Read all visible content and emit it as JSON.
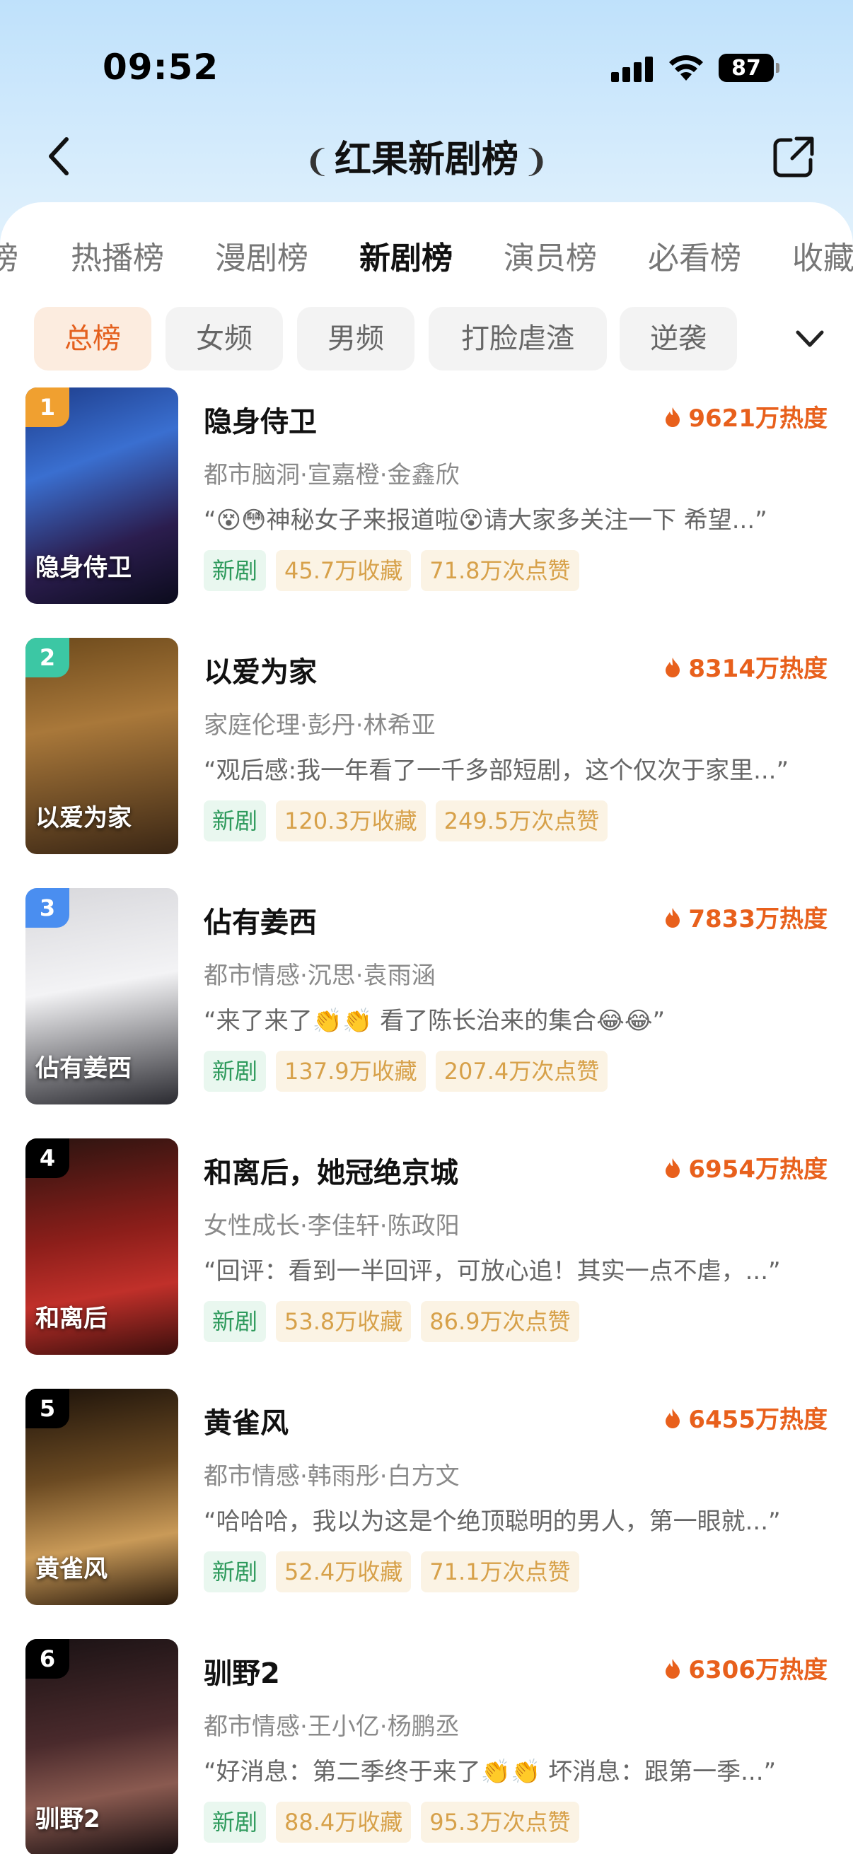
{
  "status": {
    "time": "09:52",
    "battery": "87"
  },
  "header": {
    "title": "红果新剧榜"
  },
  "tabs": [
    {
      "label": "热播榜",
      "active": false
    },
    {
      "label": "漫剧榜",
      "active": false
    },
    {
      "label": "新剧榜",
      "active": true
    },
    {
      "label": "演员榜",
      "active": false
    },
    {
      "label": "必看榜",
      "active": false
    },
    {
      "label": "收藏榜",
      "active": false
    }
  ],
  "chips": [
    {
      "label": "总榜",
      "active": true
    },
    {
      "label": "女频",
      "active": false
    },
    {
      "label": "男频",
      "active": false
    },
    {
      "label": "打脸虐渣",
      "active": false
    },
    {
      "label": "逆袭",
      "active": false
    }
  ],
  "items": [
    {
      "rank": "1",
      "title": "隐身侍卫",
      "heat": "9621万热度",
      "meta": "都市脑洞·宣嘉橙·金鑫欣",
      "quote": "“😵😳神秘女子来报道啦😵请大家多关注一下 希望...”",
      "tag": "新剧",
      "collect": "45.7万收藏",
      "likes": "71.8万次点赞",
      "poster_text": "隐身侍卫"
    },
    {
      "rank": "2",
      "title": "以爱为家",
      "heat": "8314万热度",
      "meta": "家庭伦理·彭丹·林希亚",
      "quote": "“观后感:我一年看了一千多部短剧，这个仅次于家里...”",
      "tag": "新剧",
      "collect": "120.3万收藏",
      "likes": "249.5万次点赞",
      "poster_text": "以爱为家"
    },
    {
      "rank": "3",
      "title": "佔有姜西",
      "heat": "7833万热度",
      "meta": "都市情感·沉思·袁雨涵",
      "quote": "“来了来了👏👏 看了陈长治来的集合😂😂”",
      "tag": "新剧",
      "collect": "137.9万收藏",
      "likes": "207.4万次点赞",
      "poster_text": "佔有姜西"
    },
    {
      "rank": "4",
      "title": "和离后，她冠绝京城",
      "heat": "6954万热度",
      "meta": "女性成长·李佳轩·陈政阳",
      "quote": "“回评：看到一半回评，可放心追！其实一点不虐，...”",
      "tag": "新剧",
      "collect": "53.8万收藏",
      "likes": "86.9万次点赞",
      "poster_text": "和离后"
    },
    {
      "rank": "5",
      "title": "黄雀风",
      "heat": "6455万热度",
      "meta": "都市情感·韩雨彤·白方文",
      "quote": "“哈哈哈，我以为这是个绝顶聪明的男人，第一眼就...”",
      "tag": "新剧",
      "collect": "52.4万收藏",
      "likes": "71.1万次点赞",
      "poster_text": "黄雀风"
    },
    {
      "rank": "6",
      "title": "驯野2",
      "heat": "6306万热度",
      "meta": "都市情感·王小亿·杨鹏丞",
      "quote": "“好消息：第二季终于来了👏👏 坏消息：跟第一季...”",
      "tag": "新剧",
      "collect": "88.4万收藏",
      "likes": "95.3万次点赞",
      "poster_text": "驯野2"
    }
  ],
  "colors": {
    "accent": "#e8601c",
    "rank1": "#f0a030",
    "rank2": "#3cc7a4",
    "rank3": "#4a8ef0",
    "rankN": "#000000"
  }
}
